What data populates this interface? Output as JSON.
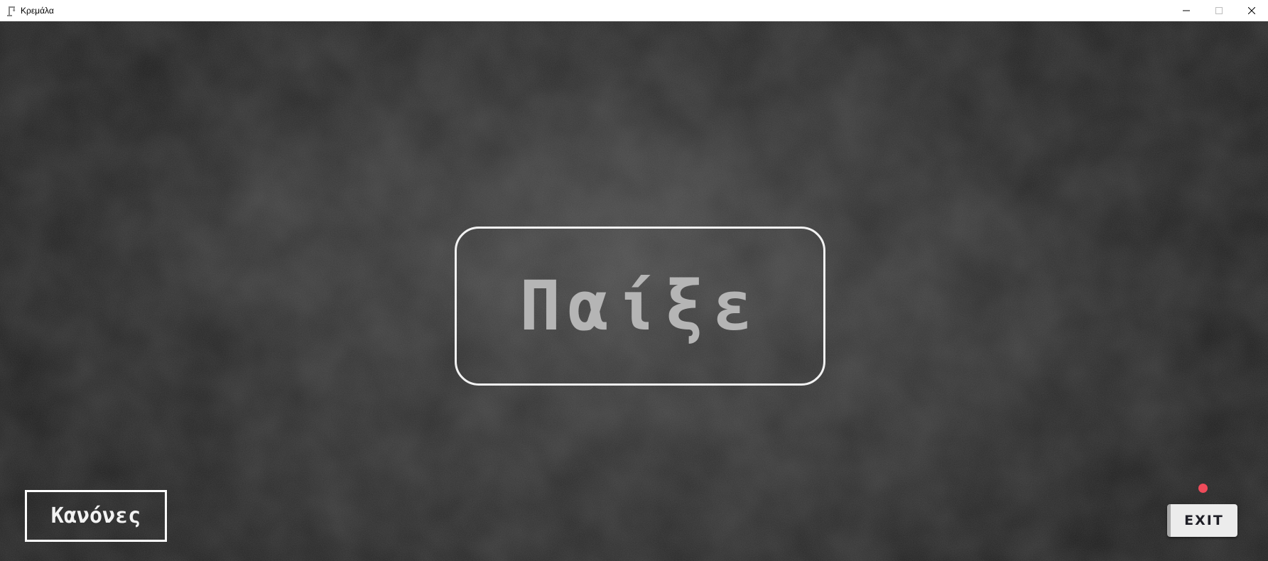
{
  "window": {
    "title": "Κρεμάλα",
    "app_icon": "gallows-icon",
    "controls": [
      "minimize-icon",
      "maximize-icon",
      "close-icon"
    ]
  },
  "main": {
    "play_label": "Παίξε",
    "rules_label": "Κανόνες",
    "exit_label": "EXIT"
  },
  "colors": {
    "background": "#2b2b2b",
    "play_text": "#b5b5b5",
    "border": "#f2f2f2",
    "exit_background": "#ececec",
    "exit_dot": "#ef4b5a"
  }
}
